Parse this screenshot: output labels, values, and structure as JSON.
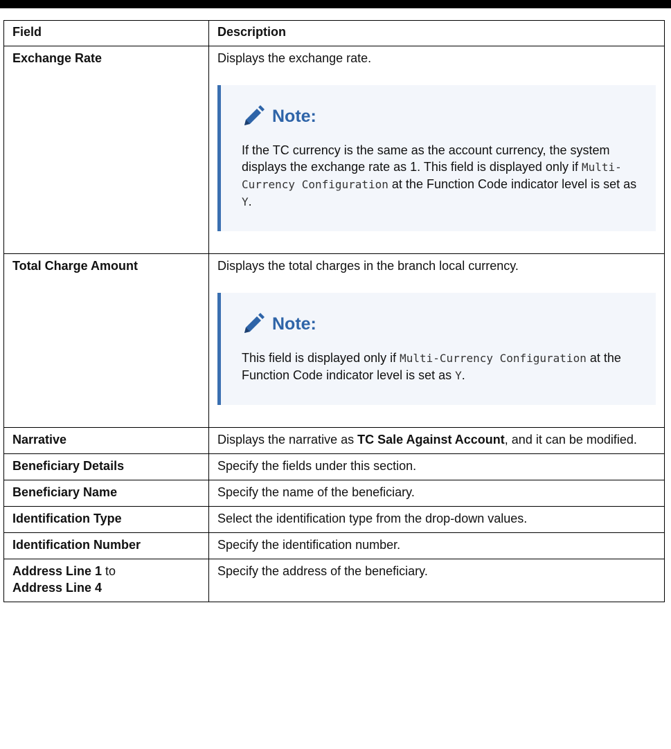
{
  "header": {
    "field": "Field",
    "description": "Description"
  },
  "rows": [
    {
      "field": "Exchange Rate",
      "description": "Displays the exchange rate.",
      "note": {
        "title": "Note:",
        "text1": "If the TC currency is the same as the account currency, the system displays the exchange rate as 1. This field is displayed only if ",
        "code1": "Multi-Currency Configuration",
        "text2": " at the Function Code indicator level is set as ",
        "code2": "Y",
        "text3": "."
      }
    },
    {
      "field": "Total Charge Amount",
      "description": "Displays the total charges in the branch local currency.",
      "note": {
        "title": "Note:",
        "text1": "This field is displayed only if ",
        "code1": "Multi-Currency Configuration",
        "text2": " at the Function Code indicator level is set as ",
        "code2": "Y",
        "text3": "."
      }
    },
    {
      "field": "Narrative",
      "description_pre": "Displays the narrative as ",
      "description_bold": "TC Sale Against Account",
      "description_post": ", and it can be modified."
    },
    {
      "field": "Beneficiary Details",
      "description": "Specify the fields under this section."
    },
    {
      "field": "Beneficiary Name",
      "description": "Specify the name of the beneficiary."
    },
    {
      "field": "Identification Type",
      "description": "Select the identification type from the drop-down values."
    },
    {
      "field": "Identification Number",
      "description": "Specify the identification number."
    },
    {
      "field_a": "Address Line 1",
      "field_mid": " to",
      "field_b": "Address Line 4",
      "description": "Specify the address of the beneficiary."
    }
  ],
  "icons": {
    "note_icon": "pencil-icon",
    "note_color": "#2e64a8",
    "accent_bar": "#3a6fb0",
    "note_bg": "#f3f6fb"
  }
}
